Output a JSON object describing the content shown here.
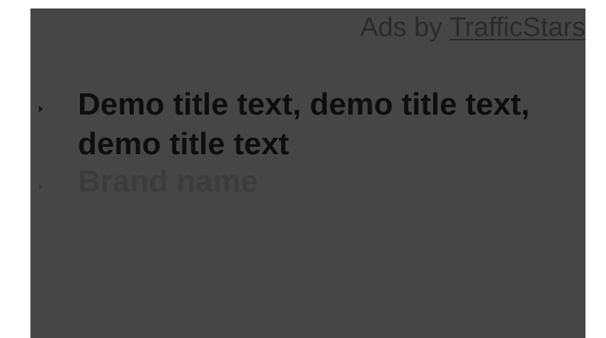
{
  "ad": {
    "header_prefix": "Ads by ",
    "header_link": "TrafficStars",
    "title": "Demo title text, demo title text, demo title text",
    "brand": "Brand name"
  },
  "colors": {
    "page_background": "#ffffff",
    "ad_background": "#464646",
    "title_text": "#0e0e0e",
    "brand_text": "#3c3c3c",
    "header_text": "#2b2b2b"
  }
}
